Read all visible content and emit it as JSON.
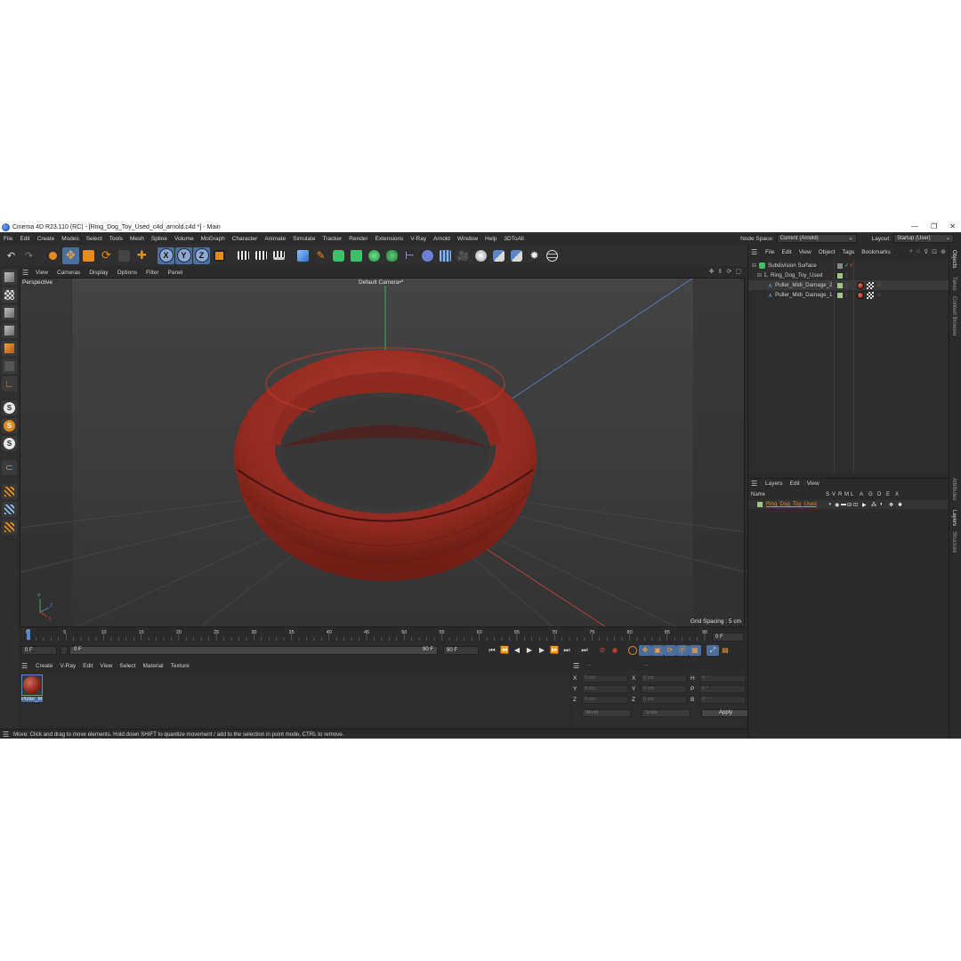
{
  "window": {
    "title": "Cinema 4D R23.110 (RC) - [Ring_Dog_Toy_Used_c4d_arnold.c4d *] - Main",
    "controls": [
      "—",
      "❐",
      "✕"
    ]
  },
  "menubar": {
    "items": [
      "File",
      "Edit",
      "Create",
      "Modes",
      "Select",
      "Tools",
      "Mesh",
      "Spline",
      "Volume",
      "MoGraph",
      "Character",
      "Animate",
      "Simulate",
      "Tracker",
      "Render",
      "Extensions",
      "V-Ray",
      "Arnold",
      "Window",
      "Help",
      "3DToAll"
    ],
    "node_space_label": "Node Space:",
    "node_space_value": "Current (Arnold)",
    "layout_label": "Layout:",
    "layout_value": "Startup (User)"
  },
  "toolbar": {
    "axis_x": "X",
    "axis_y": "Y",
    "axis_z": "Z"
  },
  "viewport": {
    "menu": [
      "View",
      "Cameras",
      "Display",
      "Options",
      "Filter",
      "Panel"
    ],
    "view_name": "Perspective",
    "camera_name": "Default Camera",
    "camera_suffix": "•*",
    "grid_spacing": "Grid Spacing : 5 cm",
    "axis_labels": {
      "y": "Y",
      "z": "Z",
      "x": "X"
    }
  },
  "timeline": {
    "ticks": [
      "0",
      "5",
      "10",
      "15",
      "20",
      "25",
      "30",
      "35",
      "40",
      "45",
      "50",
      "55",
      "60",
      "65",
      "70",
      "75",
      "80",
      "85",
      "90"
    ],
    "current_frame_field": "0 F",
    "start_field": "0 F",
    "slider_start": "0 F",
    "slider_end": "90 F",
    "end_field": "90 F",
    "right_frame": "0 F"
  },
  "material_panel": {
    "menu": [
      "Create",
      "V-Ray",
      "Edit",
      "View",
      "Select",
      "Material",
      "Texture"
    ],
    "material_name": "Puller_M"
  },
  "coordinates": {
    "header_pos": "--",
    "header_rot": "--",
    "rows": [
      {
        "a": "X",
        "av": "0 cm",
        "b": "X",
        "bv": "0 cm",
        "c": "H",
        "cv": "0 °"
      },
      {
        "a": "Y",
        "av": "0 cm",
        "b": "Y",
        "bv": "0 cm",
        "c": "P",
        "cv": "0 °"
      },
      {
        "a": "Z",
        "av": "0 cm",
        "b": "Z",
        "bv": "0 cm",
        "c": "B",
        "cv": "0 °"
      }
    ],
    "mode_world": "World",
    "mode_scale": "Scale",
    "apply": "Apply"
  },
  "status": {
    "text": "Move: Click and drag to move elements. Hold down SHIFT to quantize movement / add to the selection in point mode, CTRL to remove."
  },
  "objects_panel": {
    "menu": [
      "File",
      "Edit",
      "View",
      "Object",
      "Tags",
      "Bookmarks"
    ],
    "items": [
      {
        "name": "Subdivision Surface",
        "indent": 0
      },
      {
        "name": "Ring_Dog_Toy_Used",
        "indent": 1
      },
      {
        "name": "Puller_Midi_Damage_2",
        "indent": 2
      },
      {
        "name": "Puller_Midi_Damage_1",
        "indent": 2
      }
    ]
  },
  "layers_panel": {
    "menu": [
      "Layers",
      "Edit",
      "View"
    ],
    "name_header": "Name",
    "columns": [
      "S",
      "V",
      "R",
      "M",
      "L",
      "A",
      "G",
      "D",
      "E",
      "X"
    ],
    "layer_name": "Ring_Dog_Toy_Used"
  },
  "side_tabs": {
    "top": [
      "Objects",
      "Takes",
      "Content Browser"
    ],
    "bottom": [
      "Attributes",
      "Layers",
      "Structure"
    ]
  },
  "colors": {
    "ring": "#a83228",
    "ring_dark": "#5a1410",
    "accent": "#e58c21",
    "selection": "#4b6e9e"
  }
}
